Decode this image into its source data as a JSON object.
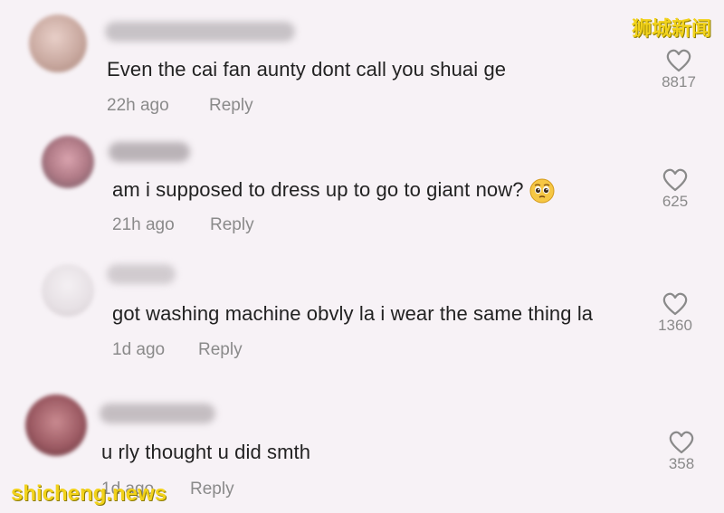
{
  "watermarks": {
    "top_right": "狮城新闻",
    "bottom_left": "shicheng.news"
  },
  "comments": [
    {
      "text": "Even the cai fan aunty dont call you shuai ge",
      "time": "22h ago",
      "reply_label": "Reply",
      "likes": "8817",
      "avatar_color": "#c9a9a0"
    },
    {
      "text": "am i supposed to dress up to go to giant now?",
      "emoji": "pleading-face-emoji",
      "time": "21h ago",
      "reply_label": "Reply",
      "likes": "625",
      "avatar_color": "#b07a86"
    },
    {
      "text": "got washing machine obvly la i wear the same thing la",
      "time": "1d ago",
      "reply_label": "Reply",
      "likes": "1360",
      "avatar_color": "#e6e0e4"
    },
    {
      "text": "u rly thought u did smth",
      "time": "1d ago",
      "reply_label": "Reply",
      "likes": "358",
      "avatar_color": "#9c5a63"
    }
  ],
  "colors": {
    "background": "#f7f2f6",
    "text": "#222222",
    "muted": "#8a8a8a",
    "watermark": "#f2d21a"
  }
}
